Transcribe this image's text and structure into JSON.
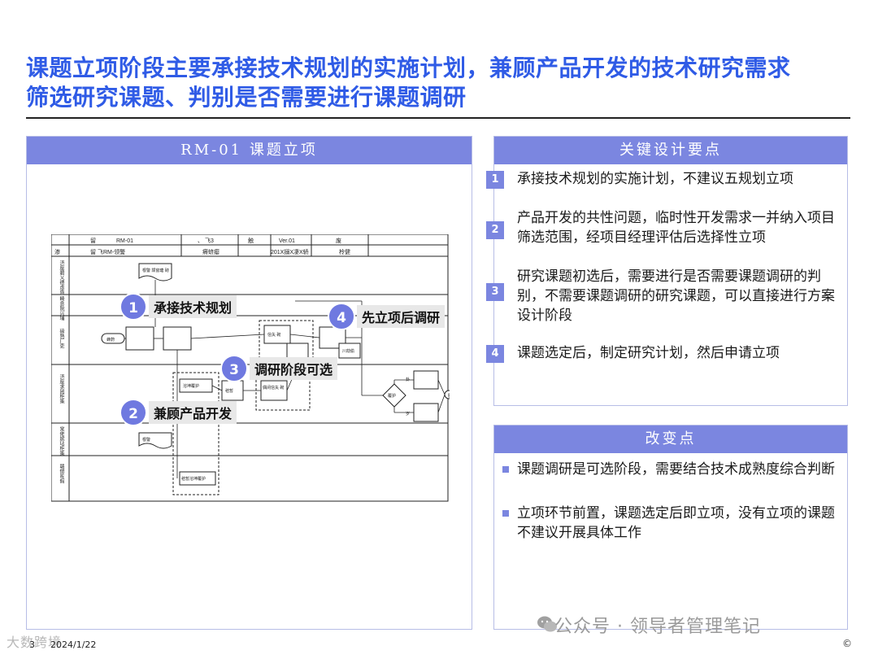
{
  "title": {
    "line1": "课题立项阶段主要承接技术规划的实施计划，兼顾产品开发的技术研究需求",
    "line2": "筛选研究课题、判别是否需要进行课题调研"
  },
  "left_panel": {
    "header": "RM-01 课题立项",
    "diagram": {
      "header_cells": [
        "留",
        "RM-01",
        "、 飞3",
        "触",
        "Ver.01",
        "废"
      ],
      "header_cells2": [
        "渗",
        "留 飞RM-领警",
        "瘠蛴瘿",
        "201X搦X凄X轿",
        "柃健"
      ],
      "lanes": [
        "济座碧乂德虑昏",
        "畸息院兴埔",
        "磅熟厂吏",
        "济座求团柜策",
        "常佬嫔玷柜策",
        "赣偿咗假"
      ],
      "boxes": {
        "b1": "根警 颌窗瑭 砌",
        "start": "蜂蔚",
        "b2": "信矢 砌",
        "b3": "川劫偷",
        "b4": "溶坤覆护",
        "b5": "秸暂",
        "b6": "偶闭信矢 砌",
        "b7": "根警",
        "b8": "秸暂溶坤覆护",
        "dia": "覆护",
        "end": "剧",
        "s1": "卦",
        "s2": "岁"
      },
      "callouts": [
        {
          "num": "1",
          "label": "承接技术规划"
        },
        {
          "num": "2",
          "label": "兼顾产品开发"
        },
        {
          "num": "3",
          "label": "调研阶段可选"
        },
        {
          "num": "4",
          "label": "先立项后调研"
        }
      ]
    }
  },
  "key_points": {
    "header": "关键设计要点",
    "items": [
      {
        "num": "1",
        "text": "承接技术规划的实施计划，不建议五规划立项"
      },
      {
        "num": "2",
        "text": "产品开发的共性问题，临时性开发需求一并纳入项目筛选范围，经项目经理评估后选择性立项"
      },
      {
        "num": "3",
        "text": "研究课题初选后，需要进行是否需要课题调研的判别，不需要课题调研的研究课题，可以直接进行方案设计阶段"
      },
      {
        "num": "4",
        "text": "课题选定后，制定研究计划，然后申请立项"
      }
    ]
  },
  "changes": {
    "header": "改变点",
    "items": [
      {
        "text": "课题调研是可选阶段，需要结合技术成熟度综合判断"
      },
      {
        "text": "立项环节前置，课题选定后即立项，没有立项的课题不建议开展具体工作"
      }
    ]
  },
  "footer": {
    "page": "3",
    "date": "2024/1/22",
    "watermark_left": "大数跨境",
    "watermark_right": "公众号 · 领导者管理笔记",
    "copyright": "©"
  },
  "colors": {
    "accent": "#2f5be6",
    "header": "#7b86e0",
    "border": "#b7bde6"
  }
}
